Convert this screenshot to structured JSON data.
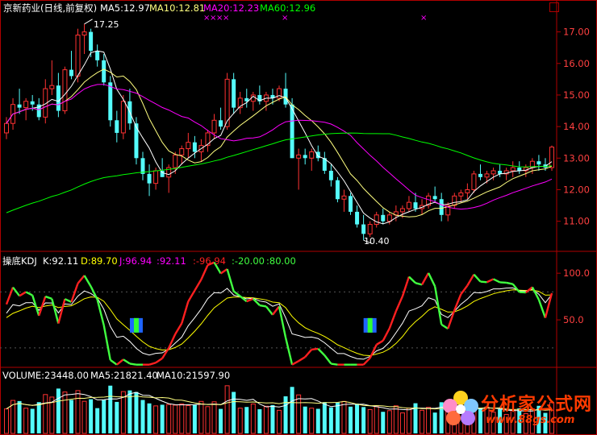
{
  "colors": {
    "bg": "#000000",
    "up": "#ff3232",
    "down": "#54fcfc",
    "ma5": "#ffffff",
    "ma10": "#ffff80",
    "ma20": "#ff00ff",
    "ma60": "#00ff00",
    "axis": "#b00000",
    "price_label": "#ff4040",
    "flat": "#ffffff",
    "k_line": "#ffffff",
    "d_line": "#ffff00",
    "j_line": "#ff00ff",
    "kdj_up": "#ff2020",
    "kdj_down": "#40ff40",
    "watermark": "#ff3a00"
  },
  "price_panel": {
    "title": "京新药业(日线,前复权)",
    "ma5": "MA5:12.97",
    "ma10": "MA10:12.81",
    "ma20": "MA20:12.23",
    "ma60": "MA60:12.96",
    "high_label": "17.25",
    "low_label": "10.40",
    "marker_glyph": "×"
  },
  "kdj_panel": {
    "title": "操底KDJ",
    "k": "K:92.11",
    "d": "D:89.70",
    "j": "J:96.94",
    "v1": ":92.11",
    "v2": ":-96.94",
    "v3": ":-20.00",
    "v4": ":80.00"
  },
  "volume_panel": {
    "title": "VOLUME:23448.00",
    "ma5": "MA5:21821.40",
    "ma10": "MA10:21597.90"
  },
  "watermark": {
    "brand": "分析家公式网",
    "url": "www.88gs.com"
  },
  "chart_data": [
    {
      "type": "candlestick",
      "title": "京新药业(日线,前复权)",
      "ylim": [
        10.2,
        17.5
      ],
      "y_ticks": [
        11.0,
        12.0,
        13.0,
        14.0,
        15.0,
        16.0,
        17.0
      ],
      "series": [
        {
          "name": "MA5",
          "value": 12.97
        },
        {
          "name": "MA10",
          "value": 12.81
        },
        {
          "name": "MA20",
          "value": 12.23
        },
        {
          "name": "MA60",
          "value": 12.96
        }
      ],
      "ohlc": [
        [
          13.8,
          14.3,
          13.6,
          14.1
        ],
        [
          14.1,
          14.9,
          13.9,
          14.7
        ],
        [
          14.7,
          15.2,
          14.4,
          14.6
        ],
        [
          14.6,
          14.9,
          14.2,
          14.8
        ],
        [
          14.8,
          15.0,
          14.5,
          14.7
        ],
        [
          14.7,
          14.9,
          14.2,
          14.3
        ],
        [
          14.3,
          15.5,
          14.1,
          15.2
        ],
        [
          15.2,
          16.1,
          15.0,
          15.3
        ],
        [
          15.3,
          15.7,
          14.3,
          14.5
        ],
        [
          14.5,
          15.9,
          14.4,
          15.8
        ],
        [
          15.8,
          16.4,
          15.5,
          15.6
        ],
        [
          15.6,
          17.1,
          15.4,
          16.9
        ],
        [
          16.9,
          17.25,
          16.3,
          17.0
        ],
        [
          17.0,
          17.1,
          16.2,
          16.4
        ],
        [
          16.4,
          16.6,
          15.9,
          16.1
        ],
        [
          16.1,
          16.3,
          15.3,
          15.4
        ],
        [
          15.4,
          15.6,
          14.0,
          14.2
        ],
        [
          14.2,
          14.5,
          13.5,
          13.8
        ],
        [
          13.8,
          15.0,
          13.6,
          14.8
        ],
        [
          14.8,
          15.2,
          13.9,
          14.1
        ],
        [
          14.1,
          14.3,
          12.8,
          13.0
        ],
        [
          13.0,
          13.2,
          12.3,
          12.5
        ],
        [
          12.5,
          12.8,
          11.8,
          12.2
        ],
        [
          12.2,
          12.7,
          12.0,
          12.6
        ],
        [
          12.6,
          13.0,
          12.4,
          12.4
        ],
        [
          12.4,
          12.8,
          11.9,
          12.7
        ],
        [
          12.7,
          13.2,
          12.5,
          13.1
        ],
        [
          13.1,
          13.4,
          12.8,
          13.3
        ],
        [
          13.3,
          13.8,
          13.0,
          13.5
        ],
        [
          13.5,
          13.7,
          13.0,
          13.2
        ],
        [
          13.2,
          13.6,
          12.9,
          13.4
        ],
        [
          13.4,
          13.9,
          13.2,
          13.8
        ],
        [
          13.8,
          14.4,
          13.6,
          14.2
        ],
        [
          14.2,
          14.6,
          13.9,
          14.0
        ],
        [
          14.0,
          15.7,
          13.9,
          15.5
        ],
        [
          15.5,
          15.7,
          14.4,
          14.6
        ],
        [
          14.6,
          15.1,
          14.4,
          14.9
        ],
        [
          14.9,
          15.2,
          14.6,
          14.8
        ],
        [
          14.8,
          15.1,
          14.5,
          15.0
        ],
        [
          15.0,
          15.3,
          14.7,
          14.8
        ],
        [
          14.8,
          15.1,
          14.5,
          15.0
        ],
        [
          15.0,
          15.2,
          14.7,
          14.9
        ],
        [
          14.9,
          15.3,
          14.8,
          15.2
        ],
        [
          15.2,
          15.7,
          14.6,
          14.7
        ],
        [
          14.7,
          14.9,
          13.0,
          13.0
        ],
        [
          13.0,
          13.3,
          12.0,
          13.1
        ],
        [
          13.1,
          13.3,
          12.8,
          13.0
        ],
        [
          13.0,
          13.3,
          12.6,
          13.2
        ],
        [
          13.2,
          13.4,
          12.9,
          13.0
        ],
        [
          13.0,
          13.2,
          12.5,
          12.6
        ],
        [
          12.6,
          12.8,
          12.1,
          12.3
        ],
        [
          12.3,
          12.4,
          11.6,
          11.7
        ],
        [
          11.7,
          12.0,
          11.3,
          11.8
        ],
        [
          11.8,
          11.9,
          11.2,
          11.3
        ],
        [
          11.3,
          11.5,
          10.8,
          10.9
        ],
        [
          10.9,
          11.2,
          10.4,
          10.6
        ],
        [
          10.6,
          11.0,
          10.5,
          10.9
        ],
        [
          10.9,
          11.3,
          10.8,
          11.2
        ],
        [
          11.2,
          11.4,
          10.9,
          11.0
        ],
        [
          11.0,
          11.3,
          10.9,
          11.2
        ],
        [
          11.2,
          11.5,
          11.0,
          11.3
        ],
        [
          11.3,
          11.5,
          11.1,
          11.4
        ],
        [
          11.4,
          11.8,
          11.3,
          11.6
        ],
        [
          11.6,
          11.9,
          11.3,
          11.4
        ],
        [
          11.4,
          11.7,
          11.2,
          11.5
        ],
        [
          11.5,
          11.9,
          11.4,
          11.8
        ],
        [
          11.8,
          12.1,
          11.6,
          11.7
        ],
        [
          11.7,
          11.9,
          11.0,
          11.2
        ],
        [
          11.2,
          11.6,
          11.0,
          11.5
        ],
        [
          11.5,
          11.9,
          11.4,
          11.8
        ],
        [
          11.8,
          12.0,
          11.6,
          11.9
        ],
        [
          11.9,
          12.2,
          11.7,
          12.0
        ],
        [
          12.0,
          12.6,
          11.9,
          12.5
        ],
        [
          12.5,
          12.8,
          12.3,
          12.4
        ],
        [
          12.4,
          12.6,
          12.2,
          12.5
        ],
        [
          12.5,
          12.7,
          12.3,
          12.6
        ],
        [
          12.6,
          12.8,
          12.4,
          12.5
        ],
        [
          12.5,
          12.7,
          12.3,
          12.6
        ],
        [
          12.6,
          12.9,
          12.4,
          12.7
        ],
        [
          12.7,
          12.9,
          12.5,
          12.6
        ],
        [
          12.6,
          12.8,
          12.4,
          12.7
        ],
        [
          12.7,
          13.0,
          12.5,
          12.9
        ],
        [
          12.9,
          13.1,
          12.6,
          12.8
        ],
        [
          12.8,
          13.0,
          12.6,
          12.7
        ],
        [
          12.7,
          13.4,
          12.6,
          13.35
        ]
      ]
    },
    {
      "type": "line",
      "title": "操底KDJ",
      "ylim": [
        0,
        120
      ],
      "y_ticks": [
        50.0,
        100.0
      ],
      "series": [
        {
          "name": "K",
          "value": 92.11
        },
        {
          "name": "D",
          "value": 89.7
        },
        {
          "name": "J",
          "value": 96.94
        }
      ],
      "reference_lines": [
        20,
        80
      ]
    },
    {
      "type": "bar",
      "title": "VOLUME",
      "series": [
        {
          "name": "VOLUME",
          "value": 23448.0
        },
        {
          "name": "MA5",
          "value": 21821.4
        },
        {
          "name": "MA10",
          "value": 21597.9
        }
      ]
    }
  ]
}
